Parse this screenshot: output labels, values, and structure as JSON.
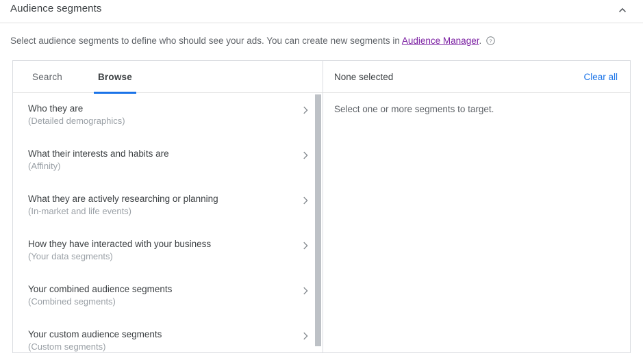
{
  "header": {
    "title": "Audience segments",
    "collapse_icon": "chevron-up-icon"
  },
  "description": {
    "text_before": "Select audience segments to define who should see your ads. You can create new segments in ",
    "link_label": "Audience Manager",
    "text_after": ".",
    "help_icon": "help-circle-icon",
    "link_color": "#7b1fa2"
  },
  "tabs": [
    {
      "label": "Search",
      "active": false
    },
    {
      "label": "Browse",
      "active": true
    }
  ],
  "browse_list": [
    {
      "title": "Who they are",
      "subtitle": "(Detailed demographics)",
      "chevron": "chevron-right-icon"
    },
    {
      "title": "What their interests and habits are",
      "subtitle": "(Affinity)",
      "chevron": "chevron-right-icon"
    },
    {
      "title": "What they are actively researching or planning",
      "subtitle": "(In-market and life events)",
      "chevron": "chevron-right-icon"
    },
    {
      "title": "How they have interacted with your business",
      "subtitle": "(Your data segments)",
      "chevron": "chevron-right-icon"
    },
    {
      "title": "Your combined audience segments",
      "subtitle": "(Combined segments)",
      "chevron": "chevron-right-icon"
    },
    {
      "title": "Your custom audience segments",
      "subtitle": "(Custom segments)",
      "chevron": "chevron-right-icon"
    }
  ],
  "selection_panel": {
    "status": "None selected",
    "clear_all_label": "Clear all",
    "empty_message": "Select one or more segments to target."
  },
  "colors": {
    "accent": "#1a73e8",
    "text_primary": "#3c4043",
    "text_secondary": "#5f6368",
    "text_muted": "#9aa0a6",
    "border": "#dadce0",
    "scrollbar": "#bdc1c6"
  }
}
